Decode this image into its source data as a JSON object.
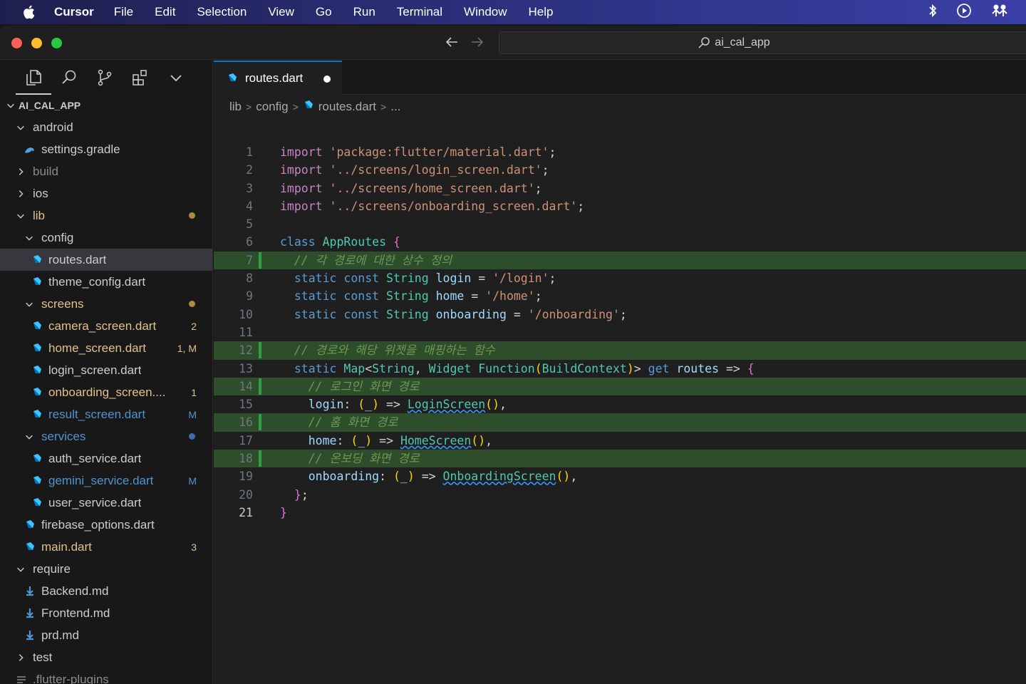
{
  "menubar": {
    "app": "Cursor",
    "items": [
      "File",
      "Edit",
      "Selection",
      "View",
      "Go",
      "Run",
      "Terminal",
      "Window",
      "Help"
    ]
  },
  "titlebar": {
    "search": "ai_cal_app"
  },
  "sidebar": {
    "root": "AI_CAL_APP",
    "tree": [
      {
        "label": "android",
        "type": "folder-open",
        "color": "#cccccc"
      },
      {
        "label": "settings.gradle",
        "type": "gradle",
        "color": "#cccccc"
      },
      {
        "label": "build",
        "type": "folder",
        "color": "#8b8b8b"
      },
      {
        "label": "ios",
        "type": "folder",
        "color": "#cccccc"
      },
      {
        "label": "lib",
        "type": "folder-open",
        "color": "#e2c08d",
        "dot": "#b08a3e"
      },
      {
        "label": "config",
        "type": "folder-open",
        "color": "#cccccc"
      },
      {
        "label": "routes.dart",
        "type": "dart",
        "color": "#cccccc",
        "selected": true
      },
      {
        "label": "theme_config.dart",
        "type": "dart",
        "color": "#cccccc"
      },
      {
        "label": "screens",
        "type": "folder-open",
        "color": "#e2c08d",
        "dot": "#b08a3e"
      },
      {
        "label": "camera_screen.dart",
        "type": "dart",
        "color": "#e2c08d",
        "badge": "2"
      },
      {
        "label": "home_screen.dart",
        "type": "dart",
        "color": "#e2c08d",
        "badge": "1, M"
      },
      {
        "label": "login_screen.dart",
        "type": "dart",
        "color": "#cccccc"
      },
      {
        "label": "onboarding_screen....",
        "type": "dart",
        "color": "#e2c08d",
        "badge": "1"
      },
      {
        "label": "result_screen.dart",
        "type": "dart",
        "color": "#4e94ce",
        "badge": "M"
      },
      {
        "label": "services",
        "type": "folder-open",
        "color": "#4e94ce",
        "dot": "#3a6ea5"
      },
      {
        "label": "auth_service.dart",
        "type": "dart",
        "color": "#cccccc"
      },
      {
        "label": "gemini_service.dart",
        "type": "dart",
        "color": "#4e94ce",
        "badge": "M"
      },
      {
        "label": "user_service.dart",
        "type": "dart",
        "color": "#cccccc"
      },
      {
        "label": "firebase_options.dart",
        "type": "dart",
        "color": "#cccccc"
      },
      {
        "label": "main.dart",
        "type": "dart",
        "color": "#e2c08d",
        "badge": "3"
      },
      {
        "label": "require",
        "type": "folder-open",
        "color": "#cccccc"
      },
      {
        "label": "Backend.md",
        "type": "md",
        "color": "#cccccc"
      },
      {
        "label": "Frontend.md",
        "type": "md",
        "color": "#cccccc"
      },
      {
        "label": "prd.md",
        "type": "md",
        "color": "#cccccc"
      },
      {
        "label": "test",
        "type": "folder",
        "color": "#cccccc"
      },
      {
        "label": ".flutter-plugins",
        "type": "txt",
        "color": "#8b8b8b"
      }
    ]
  },
  "editor": {
    "tab": "routes.dart",
    "breadcrumb": [
      "lib",
      "config",
      "routes.dart",
      "..."
    ],
    "lines": [
      "import 'package:flutter/material.dart';",
      "import '../screens/login_screen.dart';",
      "import '../screens/home_screen.dart';",
      "import '../screens/onboarding_screen.dart';",
      "",
      "class AppRoutes {",
      "  // 각 경로에 대한 상수 정의",
      "  static const String login = '/login';",
      "  static const String home = '/home';",
      "  static const String onboarding = '/onboarding';",
      "",
      "  // 경로와 해당 위젯을 매핑하는 함수",
      "  static Map<String, Widget Function(BuildContext)> get routes => {",
      "    // 로그인 화면 경로",
      "    login: (_) => LoginScreen(),",
      "    // 홈 화면 경로",
      "    home: (_) => HomeScreen(),",
      "    // 온보딩 화면 경로",
      "    onboarding: (_) => OnboardingScreen(),",
      "  };",
      "}"
    ],
    "highlighted_lines": [
      7,
      12,
      14,
      16,
      18
    ],
    "active_line": 21
  }
}
